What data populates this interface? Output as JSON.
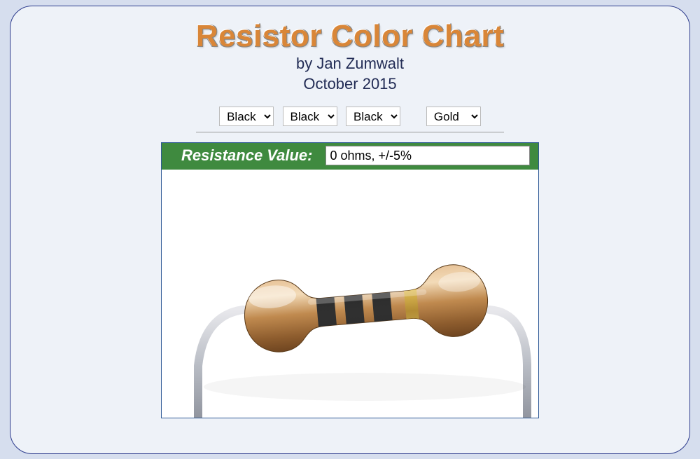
{
  "title": "Resistor Color Chart",
  "byline": "by Jan Zumwalt",
  "date": "October 2015",
  "selects": {
    "band1": "Black",
    "band2": "Black",
    "band3": "Black",
    "band4": "Gold"
  },
  "result": {
    "label": "Resistance Value:",
    "value": "0 ohms, +/-5%"
  },
  "bandColors": {
    "band1": "#1a1a1a",
    "band2": "#1a1a1a",
    "band3": "#1a1a1a",
    "band4": "#c9a227"
  }
}
